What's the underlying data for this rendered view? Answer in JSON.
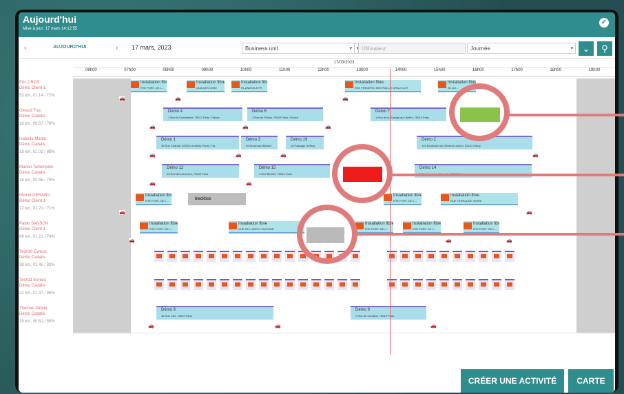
{
  "header": {
    "title": "Aujourd'hui",
    "subtitle": "Mise à jour: 17 mars 14:12:55"
  },
  "toolbar": {
    "prev": "‹",
    "today_label": "AUJOURD'HUI",
    "next": "›",
    "date": "17 mars, 2023",
    "business_unit": "Business unit",
    "user_placeholder": "Utilisateur",
    "view": "Journée",
    "filter_icon": "chevron-down-icon",
    "search_icon": "search-icon"
  },
  "timeline": {
    "date": "17/03/2023",
    "hours": [
      "06h00",
      "07h00",
      "08h00",
      "09h00",
      "10h00",
      "11h00",
      "12h00",
      "13h00",
      "14h00",
      "15h00",
      "16h00",
      "17h00",
      "18h00",
      "19h00"
    ]
  },
  "resources": [
    {
      "name": "Eric CROS",
      "team": "Démo Client 1",
      "stats": "53 km, 01:14 / 72%"
    },
    {
      "name": "Gérard Truc",
      "team": "Démo Cadalis",
      "stats": "18 km, 00:57 / 78%"
    },
    {
      "name": "Isabelle Martin",
      "team": "Démo Cadalis",
      "stats": "18 km, 01:02 / 88%"
    },
    {
      "name": "Marion Tartempion",
      "team": "Démo Cadalis",
      "stats": "18 km, 00:56 / 79%"
    },
    {
      "name": "Michel GERARD",
      "team": "Démo Client 1",
      "stats": "72 km, 01:21 / 71%"
    },
    {
      "name": "Pablo SANSON",
      "team": "Démo Client 1",
      "stats": "66 km, 01:21 / 74%"
    },
    {
      "name": "Tech10 Evreux",
      "team": "Démo Cadalis",
      "stats": "38 km, 01:45 / 83%"
    },
    {
      "name": "Tech11 Evreux",
      "team": "Démo Cadalis",
      "stats": "22 km, 01:37 / 88%"
    },
    {
      "name": "Thomas Didule",
      "team": "Démo Cadalis",
      "stats": "19 km, 00:51 / 59%"
    }
  ],
  "activities": {
    "installation": "Installation fibre",
    "addr_1": "RTE PORT. DE L...",
    "addr_2": "QUA DES OISEI",
    "addr_3": "RL ANATOLE FR",
    "addr_4": "RXE FREDERIC MISTRAL LE GRAU DU R",
    "addr_5": "AV DU...",
    "demo4": "Démo 4",
    "demo4_addr": "1 Rue la Condamine, 75017 Paris, France",
    "demo6": "Démo 6",
    "demo6_addr": "3 Rue de Poissy, 75005 Paris, France",
    "demo7": "Démo 7",
    "demo7_addr": "1 Rue de la Grange aux Belles, 75010 Paris",
    "demo1": "Démo 1",
    "demo1_addr": "35 Rue Chaptal, 92300 Levallois-Perret, Fra",
    "demo3": "Démo 3",
    "demo3_addr": "39 Boulevard Beaum",
    "demo19": "Démo 19",
    "demo19_addr": "15 Passage Geffroy",
    "demo2": "Démo 2",
    "demo2_addr": "120 Boulevard du Général Leclerc, 92110 Clichy",
    "demo12": "Démo 12",
    "demo12_addr": "40 Rue des Archives, 75003 Paris",
    "demo15": "Démo 15",
    "demo15_addr": "4 Rue Blomet, 75015 Paris",
    "demo14": "Démo 14",
    "demo14_addr": "5 Boulevard de Grenelle, 75015 Paris",
    "blackbox": "blackbox",
    "demo8": "Démo 8",
    "demo8_addr": "45 Rue Cler, 75019 Paris",
    "demo9": "Démo 9",
    "demo9_addr": "7 Rue de Cambrai, 75019 Paris",
    "inst_fibre_addr": "CHE DE L ASPIC CAVERNE",
    "inst_addr_6": "RUE TERRAUDE VIEIRE"
  },
  "buttons": {
    "create": "CRÉER UNE ACTIVITÉ",
    "map": "CARTE"
  },
  "colors": {
    "teal": "#2f8d8e",
    "accent_red": "#ee1b1b",
    "accent_green": "#8bc34a",
    "annotation": "#e07b7b"
  }
}
